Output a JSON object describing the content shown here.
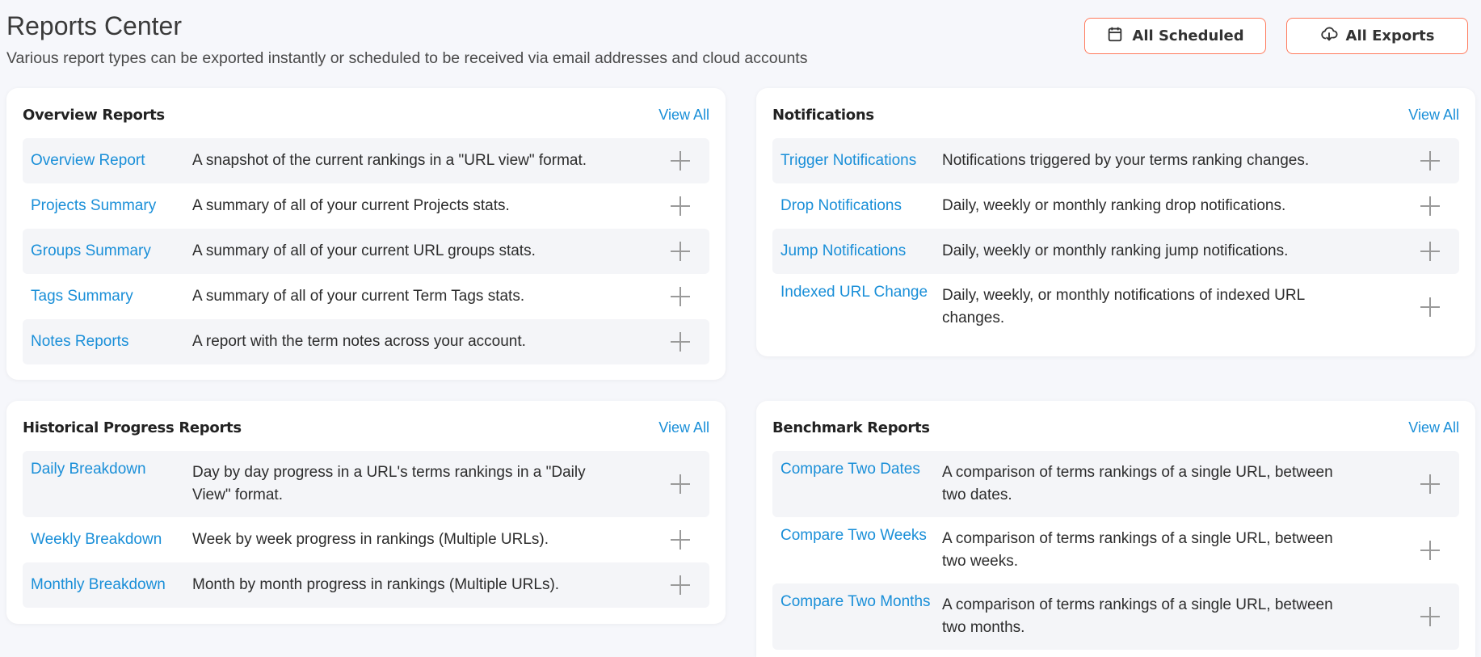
{
  "header": {
    "title": "Reports Center",
    "subtitle": "Various report types can be exported instantly or scheduled to be received via email addresses and cloud accounts",
    "all_scheduled_label": "All Scheduled",
    "all_exports_label": "All Exports"
  },
  "colors": {
    "accent": "#1a8fd8",
    "button_border": "#ff7a5c"
  },
  "cards": [
    {
      "title": "Overview Reports",
      "view_all": "View All",
      "rows": [
        {
          "name": "Overview Report",
          "desc": "A snapshot of the current rankings in a \"URL view\" format."
        },
        {
          "name": "Projects Summary",
          "desc": "A summary of all of your current Projects stats."
        },
        {
          "name": "Groups Summary",
          "desc": "A summary of all of your current URL groups stats."
        },
        {
          "name": "Tags Summary",
          "desc": "A summary of all of your current Term Tags stats."
        },
        {
          "name": "Notes Reports",
          "desc": "A report with the term notes across your account."
        }
      ]
    },
    {
      "title": "Notifications",
      "view_all": "View All",
      "rows": [
        {
          "name": "Trigger Notifications",
          "desc": "Notifications triggered by your terms ranking changes."
        },
        {
          "name": "Drop Notifications",
          "desc": "Daily, weekly or monthly ranking drop notifications."
        },
        {
          "name": "Jump Notifications",
          "desc": "Daily, weekly or monthly ranking jump notifications."
        },
        {
          "name": "Indexed URL Change",
          "desc": "Daily, weekly, or monthly notifications of indexed URL changes."
        }
      ]
    },
    {
      "title": "Historical Progress Reports",
      "view_all": "View All",
      "rows": [
        {
          "name": "Daily Breakdown",
          "desc": "Day by day progress in a URL's terms rankings in a \"Daily View\" format."
        },
        {
          "name": "Weekly Breakdown",
          "desc": "Week by week progress in rankings (Multiple URLs)."
        },
        {
          "name": "Monthly Breakdown",
          "desc": "Month by month progress in rankings (Multiple URLs)."
        }
      ]
    },
    {
      "title": "Benchmark Reports",
      "view_all": "View All",
      "rows": [
        {
          "name": "Compare Two Dates",
          "desc": "A comparison of terms rankings of a single URL, between two dates."
        },
        {
          "name": "Compare Two Weeks",
          "desc": "A comparison of terms rankings of a single URL, between two weeks."
        },
        {
          "name": "Compare Two Months",
          "desc": "A comparison of terms rankings of a single URL, between two months."
        }
      ]
    }
  ]
}
